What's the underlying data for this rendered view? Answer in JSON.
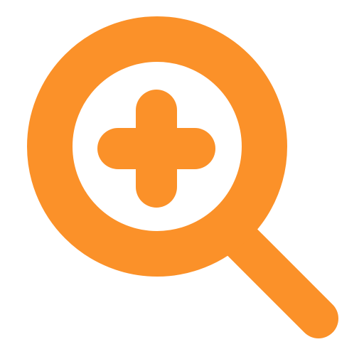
{
  "icon": {
    "name": "zoom-in-icon",
    "color": "#FB9129",
    "background": "#FFFFFF"
  }
}
